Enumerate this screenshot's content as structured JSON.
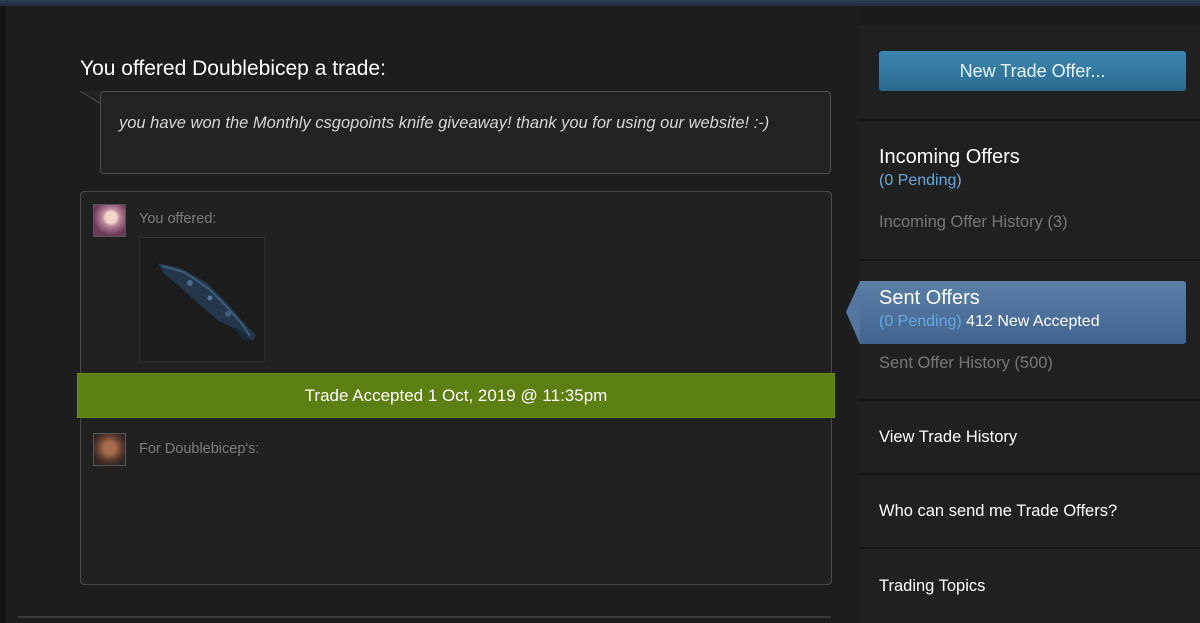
{
  "trade": {
    "title": "You offered Doublebicep a trade:",
    "message": "you have won the Monthly csgopoints knife giveaway! thank you for using our website! :-)",
    "you_offered_label": "You offered:",
    "for_label": "For Doublebicep's:",
    "status_banner": "Trade Accepted 1 Oct, 2019 @ 11:35pm",
    "item_icon": "knife-icon"
  },
  "sidebar": {
    "new_offer_button": "New Trade Offer...",
    "incoming": {
      "heading": "Incoming Offers",
      "pending": "(0 Pending)",
      "history": "Incoming Offer History (3)"
    },
    "sent": {
      "heading": "Sent Offers",
      "pending": "(0 Pending)",
      "accepted": "412 New Accepted",
      "history": "Sent Offer History (500)"
    },
    "links": {
      "view_history": "View Trade History",
      "who_can_send": "Who can send me Trade Offers?",
      "topics": "Trading Topics"
    }
  },
  "colors": {
    "accepted_banner": "#5d7e10",
    "button_blue": "#3d87b0",
    "pending_blue": "#67a8e0",
    "active_item": "#4f729a"
  }
}
